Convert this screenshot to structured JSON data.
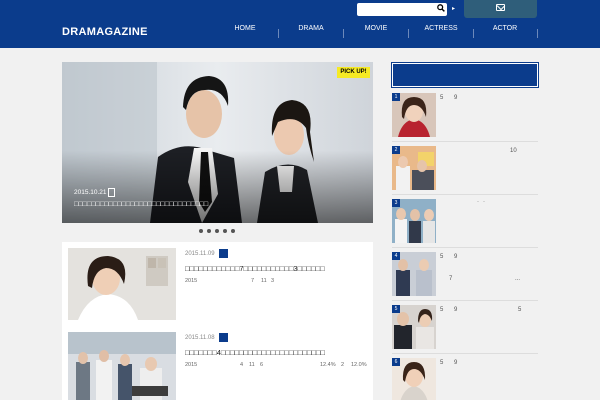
{
  "header": {
    "logo": "DRAMAGAZINE",
    "nav": [
      "HOME",
      "DRAMA",
      "MOVIE",
      "ACTRESS",
      "ACTOR"
    ],
    "search_placeholder": "",
    "search_arrow": "▸"
  },
  "slider": {
    "badge": "PICK UP!",
    "date": "2015.10.21",
    "title": "□□□□□□□□□□□□□□□□□□□□□□□□□□□□□□□",
    "dot_count": 5
  },
  "articles": [
    {
      "date": "2015.11.09",
      "title": "□□□□□□□□□□□□7□□□□□□□□□□□3□□□□□□",
      "meta": [
        "2015",
        "7",
        "11",
        "3"
      ]
    },
    {
      "date": "2015.11.08",
      "title": "□□□□□□□4□□□□□□□□□□□□□□□□□□□□□□□",
      "meta": [
        "2015",
        "4",
        "11",
        "6",
        "12.4%",
        "2",
        "12.0%"
      ]
    }
  ],
  "sidebar": {
    "ranking": [
      {
        "rank": "1",
        "texts": [
          "5",
          "9"
        ]
      },
      {
        "rank": "2",
        "texts": [
          "10"
        ]
      },
      {
        "rank": "3",
        "texts": [
          "·",
          "·"
        ]
      },
      {
        "rank": "4",
        "texts": [
          "5",
          "9",
          "7",
          "..."
        ]
      },
      {
        "rank": "5",
        "texts": [
          "5",
          "9",
          "5"
        ]
      },
      {
        "rank": "6",
        "texts": [
          "5",
          "9"
        ]
      }
    ]
  },
  "colors": {
    "brand": "#0b3c8c",
    "badge": "#f6ea24",
    "mail_button": "#2f5e7a"
  },
  "icons": {
    "search": "search-icon",
    "mail": "mail-icon",
    "category": "folder-icon"
  }
}
